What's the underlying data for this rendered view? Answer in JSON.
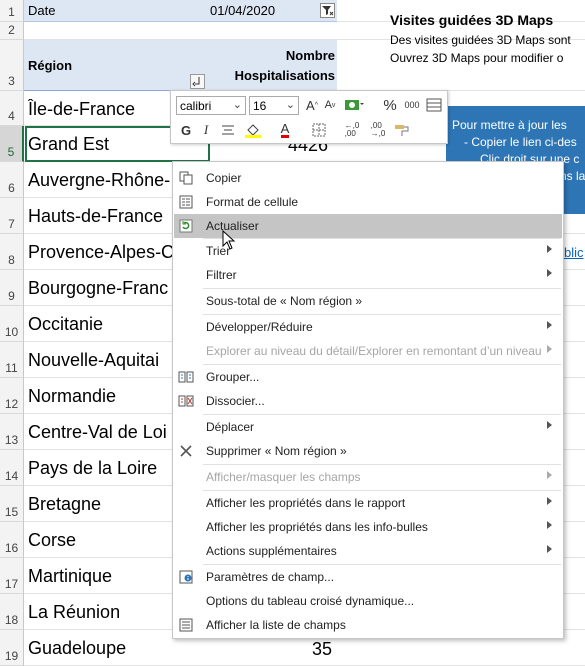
{
  "sheet": {
    "row_numbers": [
      "1",
      "2",
      "3",
      "4",
      "5",
      "6",
      "7",
      "8",
      "9",
      "10",
      "11",
      "12",
      "13",
      "14",
      "15",
      "16",
      "17",
      "18",
      "19"
    ],
    "filter_label": "Date",
    "filter_value": "01/04/2020",
    "header_region": "Région",
    "header_count_line1": "Nombre",
    "header_count_line2": "Hospitalisations",
    "rows": [
      {
        "region": "Île-de-France",
        "value": ""
      },
      {
        "region": "Grand Est",
        "value": "4426"
      },
      {
        "region": "Auvergne-Rhône-",
        "value": ""
      },
      {
        "region": "Hauts-de-France",
        "value": ""
      },
      {
        "region": "Provence-Alpes-C",
        "value": ""
      },
      {
        "region": "Bourgogne-Franc",
        "value": ""
      },
      {
        "region": "Occitanie",
        "value": ""
      },
      {
        "region": "Nouvelle-Aquitai",
        "value": ""
      },
      {
        "region": "Normandie",
        "value": ""
      },
      {
        "region": "Centre-Val de Loi",
        "value": ""
      },
      {
        "region": "Pays de la Loire",
        "value": ""
      },
      {
        "region": "Bretagne",
        "value": ""
      },
      {
        "region": "Corse",
        "value": ""
      },
      {
        "region": "Martinique",
        "value": ""
      },
      {
        "region": "La Réunion",
        "value": ""
      },
      {
        "region": "Guadeloupe",
        "value": "35"
      }
    ]
  },
  "side_panel": {
    "title": "Visites guidées 3D Maps",
    "line1": "Des visites guidées 3D Maps sont",
    "line2": "Ouvrez 3D Maps pour modifier o",
    "callout_line1": "Pour mettre à jour les",
    "callout_line2": "- Copier le lien ci-des",
    "callout_line3": "Clic droit sur une c",
    "callout_line4": "ns la",
    "link_fragment": "blic"
  },
  "mini_toolbar": {
    "font_name": "calibri",
    "font_size": "16",
    "bold": "G",
    "italic": "I",
    "percent": "%",
    "thousands": "000",
    "font_color": "A",
    "dec_inc": "←,0 ,00",
    "dec_dec": ",00 →,0",
    "colors": {
      "highlight": "#ffff00",
      "font": "#e00000"
    }
  },
  "context_menu": {
    "items": [
      {
        "label": "Copier",
        "icon": "copy-icon"
      },
      {
        "label": "Format de cellule",
        "icon": "format-cells-icon"
      },
      {
        "label": "Actualiser",
        "icon": "refresh-icon"
      },
      {
        "label": "Trier",
        "icon": ""
      },
      {
        "label": "Filtrer",
        "icon": ""
      },
      {
        "label": "Sous-total de « Nom région »",
        "icon": ""
      },
      {
        "label": "Développer/Réduire",
        "icon": ""
      },
      {
        "label": "Explorer au niveau du détail/Explorer en remontant d’un niveau",
        "icon": ""
      },
      {
        "label": "Grouper...",
        "icon": "group-icon"
      },
      {
        "label": "Dissocier...",
        "icon": "ungroup-icon"
      },
      {
        "label": "Déplacer",
        "icon": ""
      },
      {
        "label": "Supprimer « Nom région »",
        "icon": "delete-x-icon"
      },
      {
        "label": "Afficher/masquer les champs",
        "icon": ""
      },
      {
        "label": "Afficher les propriétés dans le rapport",
        "icon": ""
      },
      {
        "label": "Afficher les propriétés dans les info-bulles",
        "icon": ""
      },
      {
        "label": "Actions supplémentaires",
        "icon": ""
      },
      {
        "label": "Paramètres de champ...",
        "icon": "field-settings-icon"
      },
      {
        "label": "Options du tableau croisé dynamique...",
        "icon": ""
      },
      {
        "label": "Afficher la liste de champs",
        "icon": "field-list-icon"
      }
    ]
  }
}
